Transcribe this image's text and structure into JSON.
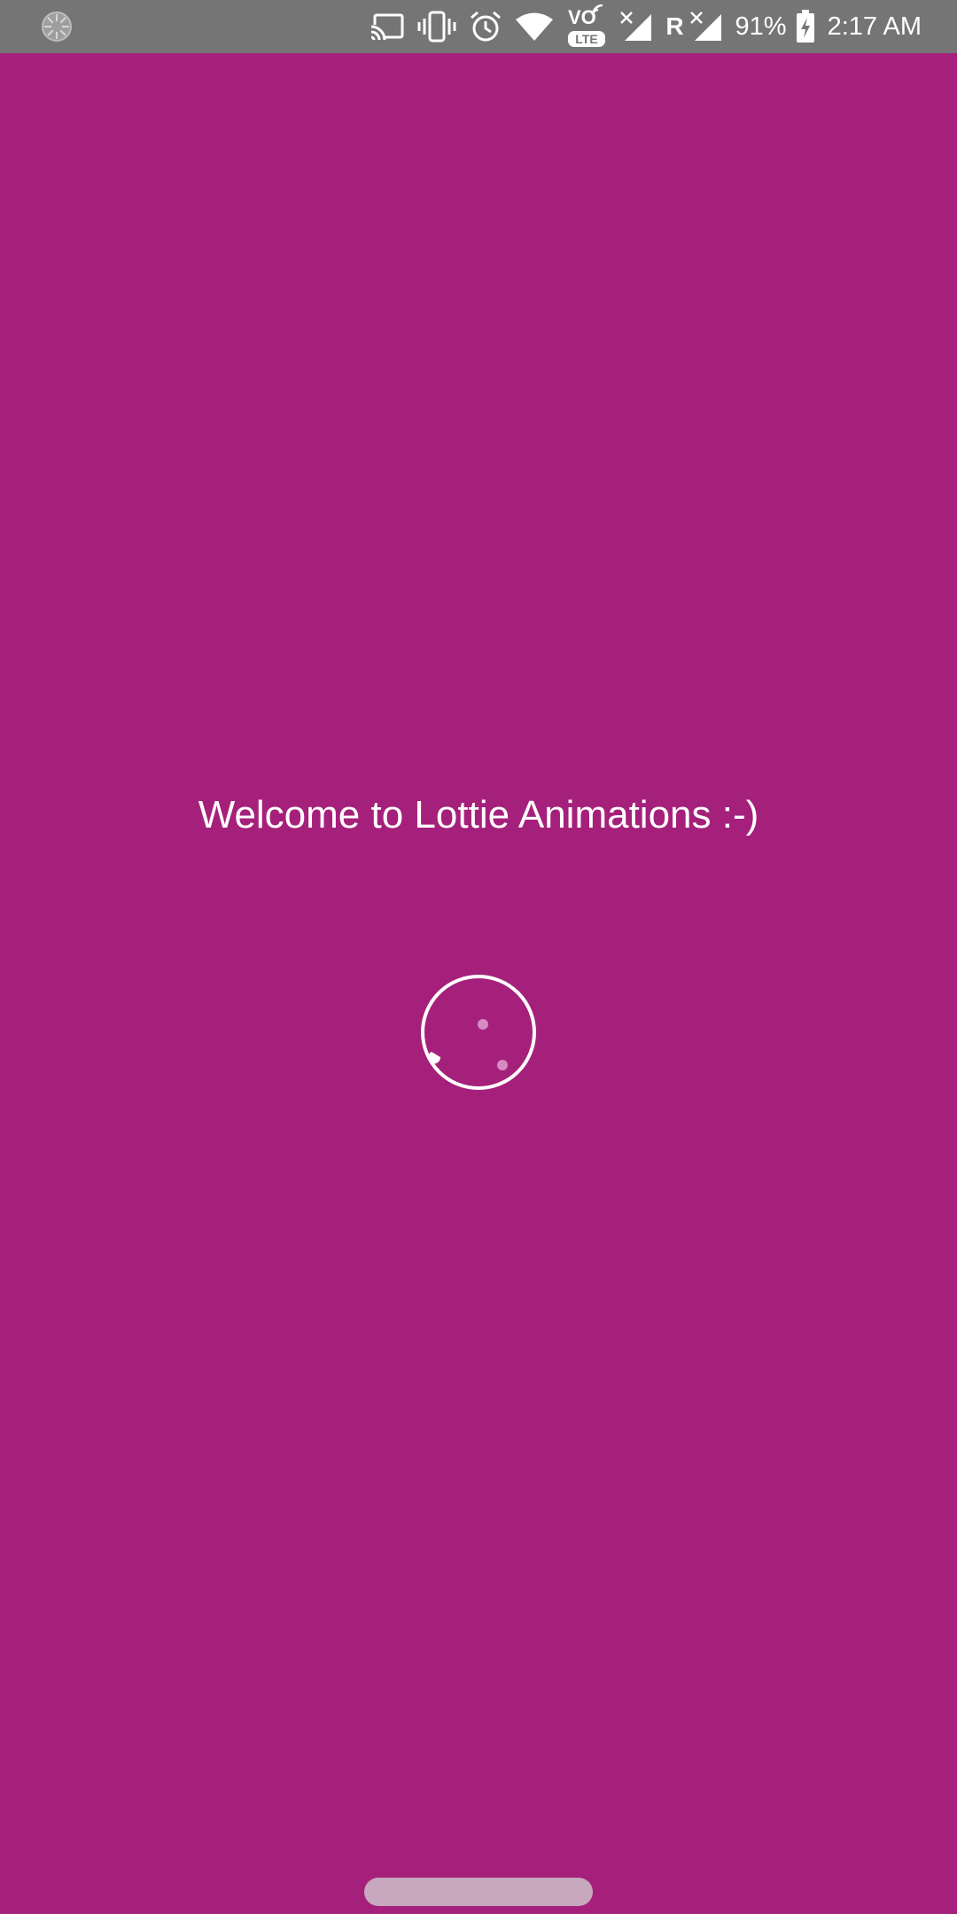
{
  "status_bar": {
    "icons": [
      "spinner-icon",
      "cast-icon",
      "vibrate-icon",
      "alarm-icon",
      "wifi-icon",
      "volte-icon",
      "signal-no-icon",
      "signal-roaming-icon",
      "battery-charging-icon"
    ],
    "volte_top": "VO",
    "volte_bottom": "LTE",
    "roaming_label": "R",
    "battery_percent": "91%",
    "time": "2:17 AM"
  },
  "main": {
    "welcome_text": "Welcome to Lottie Animations :-)",
    "loader_icon": "loading-animation-icon"
  },
  "colors": {
    "background": "#a5207b",
    "status_bar": "#757575",
    "text": "#ffffff",
    "home_indicator": "#c7a8bf"
  }
}
